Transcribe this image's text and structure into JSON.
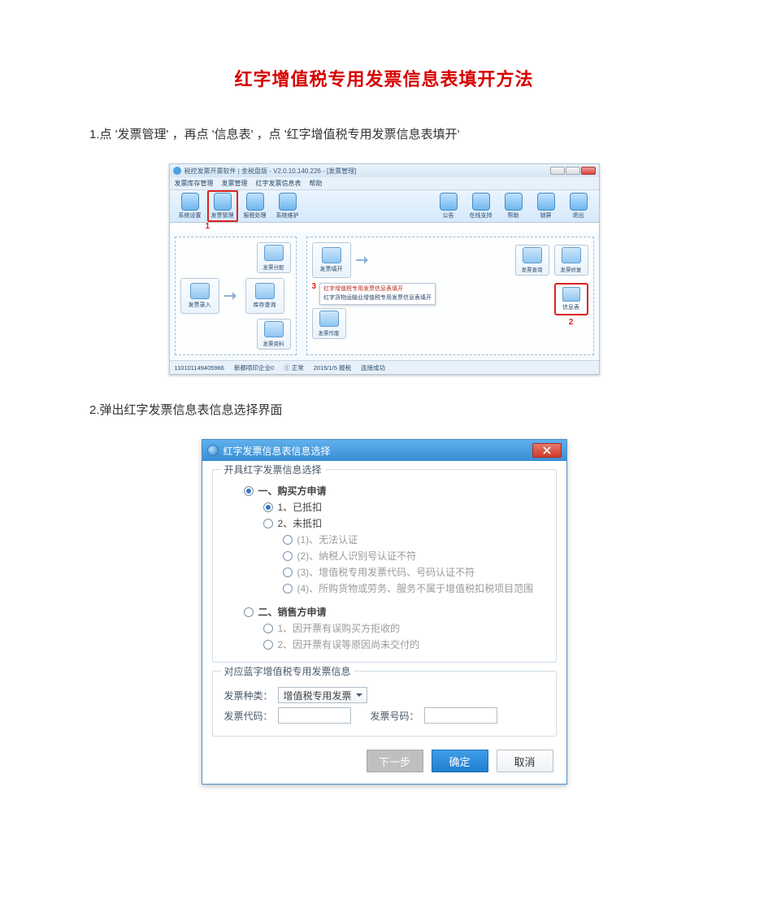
{
  "title": "红字增值税专用发票信息表填开方法",
  "step1": "1.点 '发票管理' ，再点 '信息表' ，点 '红字增值税专用发票信息表填开'",
  "step2": "2.弹出红字发票信息表信息选择界面",
  "app": {
    "titlebar": "税控发票开票软件 | 金税盘版 - V2.0.10.140.226 - [发票管理]",
    "menus": [
      "发票库存管理",
      "发票管理",
      "红字发票信息表",
      "帮助"
    ],
    "toolbar_left": [
      "系统设置",
      "发票管理",
      "报税处理",
      "系统维护"
    ],
    "toolbar_red_index": 1,
    "toolbar_right": [
      "公告",
      "在线支持",
      "帮助",
      "锁屏",
      "退出"
    ],
    "flow_left": {
      "top": "发票分配",
      "bottom_left": "发票录入",
      "bottom_right": "库存查询"
    },
    "flow_right": {
      "top_left": "发票填开",
      "top_mid": "发票查询",
      "top_right": "发票修复",
      "popup_line1": "红字增值税专用发票信息表填开",
      "popup_line2": "红字货物运输业增值税专用发票信息表填开",
      "bottom_left": "发票作废",
      "info_btn": "信息表"
    },
    "red_labels": {
      "r1": "1",
      "r2": "2",
      "r3": "3"
    },
    "status": [
      "110101149405966",
      "新都喷印企业0",
      "① 正常",
      "2015/1/5 报税",
      "连接成功"
    ]
  },
  "dlg": {
    "title": "红字发票信息表信息选择",
    "group1_legend": "开具红字发票信息选择",
    "opt_buyer_title": "一、购买方申请",
    "opt_buyer_1": "1、已抵扣",
    "opt_buyer_2": "2、未抵扣",
    "opt_buyer_2_1": "(1)、无法认证",
    "opt_buyer_2_2": "(2)、纳税人识别号认证不符",
    "opt_buyer_2_3": "(3)、增值税专用发票代码、号码认证不符",
    "opt_buyer_2_4": "(4)、所购货物或劳务、服务不属于增值税扣税项目范围",
    "opt_seller_title": "二、销售方申请",
    "opt_seller_1": "1、因开票有误购买方拒收的",
    "opt_seller_2": "2、因开票有误等原因尚未交付的",
    "group2_legend": "对应蓝字增值税专用发票信息",
    "label_kind": "发票种类：",
    "kind_value": "增值税专用发票",
    "label_code": "发票代码：",
    "label_num": "发票号码：",
    "btn_next": "下一步",
    "btn_ok": "确定",
    "btn_cancel": "取消"
  }
}
